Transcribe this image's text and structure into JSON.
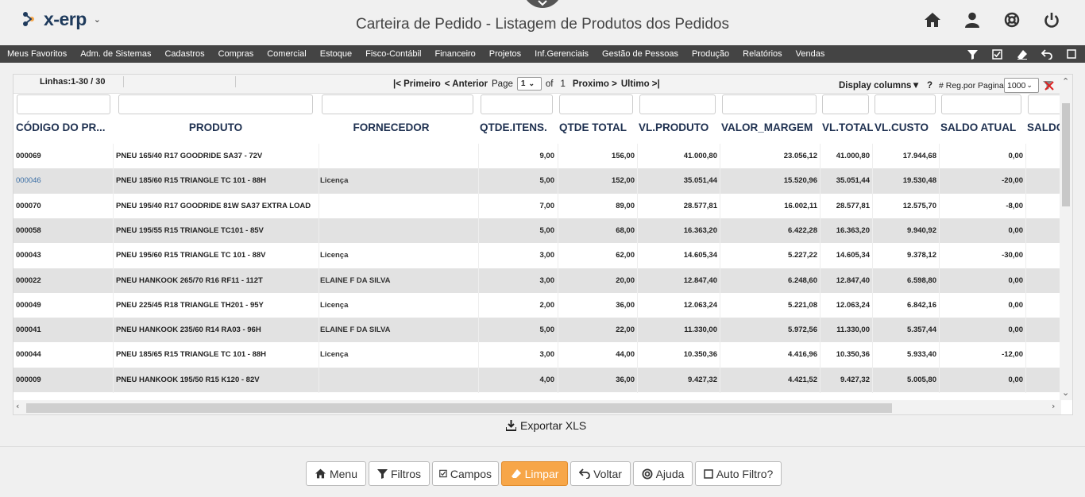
{
  "header": {
    "brand": "x-erp",
    "title": "Carteira de Pedido - Listagem de Produtos dos Pedidos",
    "icons": [
      "home-icon",
      "user-icon",
      "lifebuoy-icon",
      "power-icon"
    ]
  },
  "menu": {
    "items": [
      "Meus Favoritos",
      "Adm. de Sistemas",
      "Cadastros",
      "Compras",
      "Comercial",
      "Estoque",
      "Fisco-Contábil",
      "Financeiro",
      "Projetos",
      "Inf.Gerenciais",
      "Gestão de Pessoas",
      "Produção",
      "Relatórios",
      "Vendas"
    ],
    "tools": [
      "filter-icon",
      "checkbox-icon",
      "eraser-icon",
      "undo-icon",
      "square-icon"
    ]
  },
  "pager": {
    "lines": "Linhas:1-30 / 30",
    "first": "|< Primeiro",
    "prev": "< Anterior",
    "page_label": "Page",
    "page_value": "1",
    "of_label": "of",
    "total_pages": "1",
    "next": "Proximo >",
    "last": "Ultimo >|",
    "display_columns": "Display columns▼",
    "help": "?",
    "reg_label": "# Reg.por Pagina",
    "reg_value": "1000"
  },
  "table": {
    "headers": [
      "CÓDIGO DO PR...",
      "PRODUTO",
      "FORNECEDOR",
      "QTDE.ITENS.",
      "QTDE TOTAL",
      "VL.PRODUTO",
      "VALOR_MARGEM",
      "VL.TOTAL",
      "VL.CUSTO",
      "SALDO ATUAL",
      "SALDO"
    ],
    "rows": [
      {
        "codigo": "000069",
        "produto": "PNEU 165/40 R17 GOODRIDE SA37 - 72V",
        "fornecedor": "",
        "qtde_itens": "9,00",
        "qtde_total": "156,00",
        "vl_produto": "41.000,80",
        "valor_margem": "23.056,12",
        "vl_total": "41.000,80",
        "vl_custo": "17.944,68",
        "saldo_atual": "0,00"
      },
      {
        "codigo": "000046",
        "produto": "PNEU 185/60 R15 TRIANGLE TC 101 - 88H",
        "fornecedor": "Licença",
        "qtde_itens": "5,00",
        "qtde_total": "152,00",
        "vl_produto": "35.051,44",
        "valor_margem": "15.520,96",
        "vl_total": "35.051,44",
        "vl_custo": "19.530,48",
        "saldo_atual": "-20,00",
        "link": true
      },
      {
        "codigo": "000070",
        "produto": "PNEU 195/40 R17 GOODRIDE 81W SA37 EXTRA LOAD",
        "fornecedor": "",
        "qtde_itens": "7,00",
        "qtde_total": "89,00",
        "vl_produto": "28.577,81",
        "valor_margem": "16.002,11",
        "vl_total": "28.577,81",
        "vl_custo": "12.575,70",
        "saldo_atual": "-8,00"
      },
      {
        "codigo": "000058",
        "produto": "PNEU 195/55 R15 TRIANGLE TC101 - 85V",
        "fornecedor": "",
        "qtde_itens": "5,00",
        "qtde_total": "68,00",
        "vl_produto": "16.363,20",
        "valor_margem": "6.422,28",
        "vl_total": "16.363,20",
        "vl_custo": "9.940,92",
        "saldo_atual": "0,00"
      },
      {
        "codigo": "000043",
        "produto": "PNEU 195/60 R15 TRIANGLE TC 101 - 88V",
        "fornecedor": "Licença",
        "qtde_itens": "3,00",
        "qtde_total": "62,00",
        "vl_produto": "14.605,34",
        "valor_margem": "5.227,22",
        "vl_total": "14.605,34",
        "vl_custo": "9.378,12",
        "saldo_atual": "-30,00"
      },
      {
        "codigo": "000022",
        "produto": "PNEU HANKOOK 265/70 R16 RF11 - 112T",
        "fornecedor": "ELAINE F DA SILVA",
        "qtde_itens": "3,00",
        "qtde_total": "20,00",
        "vl_produto": "12.847,40",
        "valor_margem": "6.248,60",
        "vl_total": "12.847,40",
        "vl_custo": "6.598,80",
        "saldo_atual": "0,00"
      },
      {
        "codigo": "000049",
        "produto": "PNEU 225/45 R18 TRIANGLE TH201 - 95Y",
        "fornecedor": "Licença",
        "qtde_itens": "2,00",
        "qtde_total": "36,00",
        "vl_produto": "12.063,24",
        "valor_margem": "5.221,08",
        "vl_total": "12.063,24",
        "vl_custo": "6.842,16",
        "saldo_atual": "0,00"
      },
      {
        "codigo": "000041",
        "produto": "PNEU HANKOOK 235/60 R14 RA03 - 96H",
        "fornecedor": "ELAINE F DA SILVA",
        "qtde_itens": "5,00",
        "qtde_total": "22,00",
        "vl_produto": "11.330,00",
        "valor_margem": "5.972,56",
        "vl_total": "11.330,00",
        "vl_custo": "5.357,44",
        "saldo_atual": "0,00"
      },
      {
        "codigo": "000044",
        "produto": "PNEU 185/65 R15 TRIANGLE TC 101 - 88H",
        "fornecedor": "Licença",
        "qtde_itens": "3,00",
        "qtde_total": "44,00",
        "vl_produto": "10.350,36",
        "valor_margem": "4.416,96",
        "vl_total": "10.350,36",
        "vl_custo": "5.933,40",
        "saldo_atual": "-12,00"
      },
      {
        "codigo": "000009",
        "produto": "PNEU HANKOOK 195/50 R15 K120 - 82V",
        "fornecedor": "",
        "qtde_itens": "4,00",
        "qtde_total": "36,00",
        "vl_produto": "9.427,32",
        "valor_margem": "4.421,52",
        "vl_total": "9.427,32",
        "vl_custo": "5.005,80",
        "saldo_atual": "0,00"
      }
    ]
  },
  "export_label": "Exportar XLS",
  "footer": {
    "buttons": [
      {
        "label": "Menu",
        "icon": "home-icon"
      },
      {
        "label": "Filtros",
        "icon": "filter-icon"
      },
      {
        "label": "Campos",
        "icon": "checkbox-icon"
      },
      {
        "label": "Limpar",
        "icon": "eraser-icon",
        "active": true
      },
      {
        "label": "Voltar",
        "icon": "undo-icon"
      },
      {
        "label": "Ajuda",
        "icon": "lifebuoy-icon"
      },
      {
        "label": "Auto Filtro?",
        "icon": "square-icon"
      }
    ]
  },
  "colors": {
    "accent": "#f7a648",
    "menubar": "#444444",
    "brand": "#1e3a5c",
    "header_text": "#1e3050",
    "link": "#3a6ea5"
  }
}
